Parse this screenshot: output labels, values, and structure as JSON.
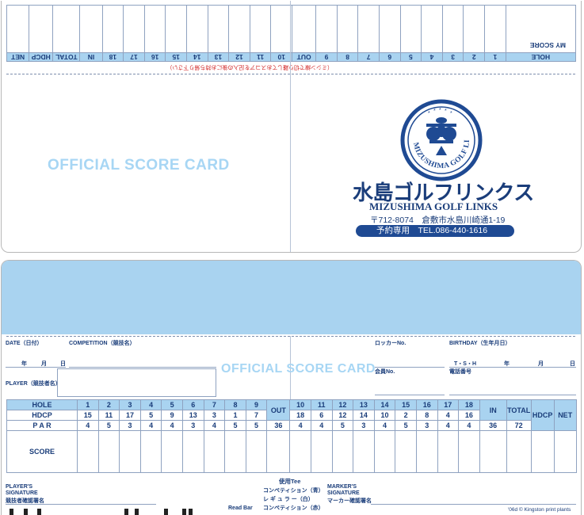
{
  "top": {
    "flipped_table": {
      "header": [
        "HOLE",
        "1",
        "2",
        "3",
        "4",
        "5",
        "6",
        "7",
        "8",
        "9",
        "OUT",
        "10",
        "11",
        "12",
        "13",
        "14",
        "15",
        "16",
        "17",
        "18",
        "IN",
        "TOTAL",
        "HDCP",
        "NET"
      ],
      "my_score_label": "MY SCORE"
    },
    "flipped_note": "（ミシン線で切り離しておスコアを記入の後にお持ち帰り下さい）",
    "official_title": "OFFICIAL SCORE CARD",
    "logo": {
      "ring_text": "MIZUSHIMA GOLF LINKS",
      "brand_jp": "水島ゴルフリンクス",
      "brand_en": "MIZUSHIMA GOLF LINKS",
      "address": "〒712-8074　倉敷市水島川崎通1-19",
      "phone": "予約専用　TEL.086-440-1616"
    }
  },
  "bottom": {
    "official_title": "OFFICIAL SCORE CARD",
    "labels": {
      "date": "DATE（日付）",
      "competition": "COMPETITION（競技名）",
      "locker": "ロッカーNo.",
      "birthday": "BIRTHDAY（生年月日）",
      "year": "年",
      "month": "月",
      "day": "日",
      "era": "T・S・H",
      "player": "PLAYER（競技者名）",
      "member_no": "会員No.",
      "phone_no": "電話番号"
    },
    "table": {
      "hole_label": "HOLE",
      "hdcp_label": "HDCP",
      "par_label": "P A R",
      "score_label": "SCORE",
      "out_label": "OUT",
      "in_label": "IN",
      "total_label": "TOTAL",
      "hdcp_col_label": "HDCP",
      "net_label": "NET",
      "holes_front": [
        "1",
        "2",
        "3",
        "4",
        "5",
        "6",
        "7",
        "8",
        "9"
      ],
      "holes_back": [
        "10",
        "11",
        "12",
        "13",
        "14",
        "15",
        "16",
        "17",
        "18"
      ],
      "hdcp_front": [
        "15",
        "11",
        "17",
        "5",
        "9",
        "13",
        "3",
        "1",
        "7"
      ],
      "hdcp_back": [
        "18",
        "6",
        "12",
        "14",
        "10",
        "2",
        "8",
        "4",
        "16"
      ],
      "par_front": [
        "4",
        "5",
        "3",
        "4",
        "4",
        "3",
        "4",
        "5"
      ],
      "par_front_last": "5",
      "par_out": "36",
      "par_back": [
        "4",
        "4",
        "5",
        "3",
        "4",
        "5",
        "3",
        "4",
        "4"
      ],
      "par_in": "36",
      "par_total": "72"
    },
    "footer": {
      "player_signature": "PLAYER'S\nSIGNATURE",
      "player_signature_jp": "競技者確認署名",
      "tee_title": "使用Tee",
      "tee_blue": "コンペティション（青）",
      "tee_white": "レ ギ ュ ラ ー（白）",
      "tee_red": "コンペティション（赤）",
      "marker_signature": "MARKER'S\nSIGNATURE",
      "marker_signature_jp": "マーカー確認署名",
      "read_bar": "Read Bar",
      "copyright": "'06d © Kingston print plants"
    }
  }
}
